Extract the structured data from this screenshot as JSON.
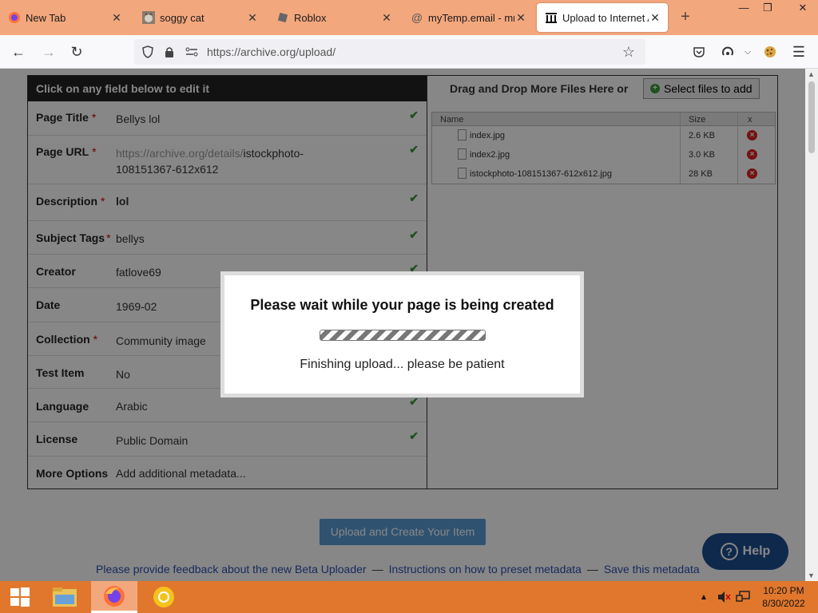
{
  "browser": {
    "tabs": [
      {
        "label": "New Tab",
        "icon": "firefox-icon",
        "active": false
      },
      {
        "label": "soggy cat",
        "icon": "cat-favicon-icon",
        "active": false
      },
      {
        "label": "Roblox",
        "icon": "roblox-icon",
        "active": false
      },
      {
        "label": "myTemp.email - mm",
        "icon": "at-sign-icon",
        "active": false
      },
      {
        "label": "Upload to Internet Ar",
        "icon": "archive-icon",
        "active": true
      }
    ],
    "new_tab": "+",
    "window_controls": {
      "minimize": "—",
      "maximize": "❐",
      "close": "✕"
    },
    "url": "https://archive.org/upload/",
    "tab_close": "✕"
  },
  "form": {
    "header": "Click on any field below to edit it",
    "fields": [
      {
        "label": "Page Title",
        "required": true,
        "value": "Bellys lol",
        "checked": true
      },
      {
        "label": "Page URL",
        "required": true,
        "url_prefix": "https://archive.org/details/",
        "value": "istockphoto-",
        "value2": "108151367-612x612",
        "checked": true
      },
      {
        "label": "Description",
        "required": true,
        "value": "lol",
        "checked": true
      },
      {
        "label": "Subject Tags",
        "required": true,
        "value": "bellys",
        "checked": true
      },
      {
        "label": "Creator",
        "required": false,
        "value": "fatlove69",
        "checked": true
      },
      {
        "label": "Date",
        "required": false,
        "value": "1969-02",
        "checked": false
      },
      {
        "label": "Collection",
        "required": true,
        "value": "Community image",
        "checked": false
      },
      {
        "label": "Test Item",
        "required": false,
        "value": "No",
        "checked": false
      },
      {
        "label": "Language",
        "required": false,
        "value": "Arabic",
        "checked": true
      },
      {
        "label": "License",
        "required": false,
        "value": "Public Domain",
        "checked": true
      },
      {
        "label": "More Options",
        "required": false,
        "value": "Add additional metadata...",
        "checked": false
      }
    ],
    "required_mark": "*",
    "check_mark": "✔"
  },
  "files": {
    "header": "Drag and Drop More Files Here or",
    "select_button": "Select files to add",
    "columns": {
      "name": "Name",
      "size": "Size",
      "x": "x"
    },
    "rows": [
      {
        "name": "index.jpg",
        "size": "2.6 KB"
      },
      {
        "name": "index2.jpg",
        "size": "3.0 KB"
      },
      {
        "name": "istockphoto-108151367-612x612.jpg",
        "size": "28 KB"
      }
    ]
  },
  "actions": {
    "upload_button": "Upload and Create Your Item",
    "help": "Help"
  },
  "footer": {
    "links": [
      "Please provide feedback about the new Beta Uploader",
      "Instructions on how to preset metadata",
      "Save this metadata"
    ],
    "separator": "—"
  },
  "modal": {
    "title": "Please wait while your page is being created",
    "message": "Finishing upload... please be patient"
  },
  "taskbar": {
    "time": "10:20 PM",
    "date": "8/30/2022"
  },
  "colors": {
    "tabbar": "#f3a77d",
    "taskbar": "#e0772d",
    "link": "#3050b0",
    "check": "#3a9a3a",
    "help": "#1d4f91"
  }
}
